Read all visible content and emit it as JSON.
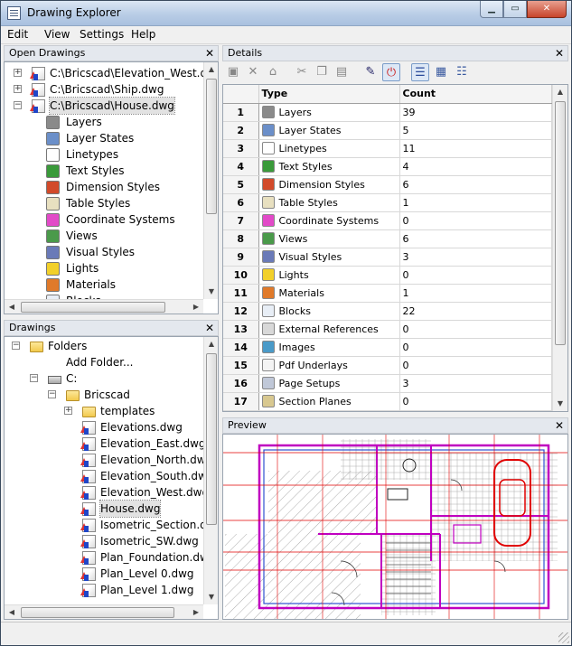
{
  "window": {
    "title": "Drawing Explorer"
  },
  "menu": [
    "Edit",
    "View",
    "Settings",
    "Help"
  ],
  "open_drawings": {
    "header": "Open Drawings",
    "files": [
      {
        "label": "C:\\Bricscad\\Elevation_West.dwg",
        "expanded": false
      },
      {
        "label": "C:\\Bricscad\\Ship.dwg",
        "expanded": false
      },
      {
        "label": "C:\\Bricscad\\House.dwg",
        "expanded": true,
        "selected": true
      }
    ],
    "children": [
      {
        "label": "Layers",
        "icon": "layers-icon"
      },
      {
        "label": "Layer States",
        "icon": "layer-states-icon"
      },
      {
        "label": "Linetypes",
        "icon": "linetypes-icon"
      },
      {
        "label": "Text Styles",
        "icon": "text-styles-icon"
      },
      {
        "label": "Dimension Styles",
        "icon": "dimension-styles-icon"
      },
      {
        "label": "Table Styles",
        "icon": "table-styles-icon"
      },
      {
        "label": "Coordinate Systems",
        "icon": "coordinate-systems-icon"
      },
      {
        "label": "Views",
        "icon": "views-icon"
      },
      {
        "label": "Visual Styles",
        "icon": "visual-styles-icon"
      },
      {
        "label": "Lights",
        "icon": "lights-icon"
      },
      {
        "label": "Materials",
        "icon": "materials-icon"
      },
      {
        "label": "Blocks",
        "icon": "blocks-icon"
      }
    ]
  },
  "drawings": {
    "header": "Drawings",
    "folders_label": "Folders",
    "add_folder_label": "Add Folder...",
    "drive_label": "C:",
    "bricscad_label": "Bricscad",
    "templates_label": "templates",
    "files": [
      "Elevations.dwg",
      "Elevation_East.dwg",
      "Elevation_North.dwg",
      "Elevation_South.dwg",
      "Elevation_West.dwg",
      "House.dwg",
      "Isometric_Section.dwg",
      "Isometric_SW.dwg",
      "Plan_Foundation.dwg",
      "Plan_Level 0.dwg",
      "Plan_Level 1.dwg"
    ],
    "selected_file": "House.dwg"
  },
  "details": {
    "header": "Details",
    "columns": {
      "type": "Type",
      "count": "Count"
    },
    "rows": [
      {
        "n": "1",
        "type": "Layers",
        "count": "39",
        "color": "#8a8a8a"
      },
      {
        "n": "2",
        "type": "Layer States",
        "count": "5",
        "color": "#6b8fc9"
      },
      {
        "n": "3",
        "type": "Linetypes",
        "count": "11",
        "color": "#ffffff"
      },
      {
        "n": "4",
        "type": "Text Styles",
        "count": "4",
        "color": "#3a9a3a"
      },
      {
        "n": "5",
        "type": "Dimension Styles",
        "count": "6",
        "color": "#d24a2a"
      },
      {
        "n": "6",
        "type": "Table Styles",
        "count": "1",
        "color": "#e8e0c0"
      },
      {
        "n": "7",
        "type": "Coordinate Systems",
        "count": "0",
        "color": "#e24ac8"
      },
      {
        "n": "8",
        "type": "Views",
        "count": "6",
        "color": "#4a9a4a"
      },
      {
        "n": "9",
        "type": "Visual Styles",
        "count": "3",
        "color": "#6a7ab8"
      },
      {
        "n": "10",
        "type": "Lights",
        "count": "0",
        "color": "#f2d02a"
      },
      {
        "n": "11",
        "type": "Materials",
        "count": "1",
        "color": "#e07a2a"
      },
      {
        "n": "12",
        "type": "Blocks",
        "count": "22",
        "color": "#e8eef6"
      },
      {
        "n": "13",
        "type": "External References",
        "count": "0",
        "color": "#d8d8d8"
      },
      {
        "n": "14",
        "type": "Images",
        "count": "0",
        "color": "#4a9ac8"
      },
      {
        "n": "15",
        "type": "Pdf Underlays",
        "count": "0",
        "color": "#f4f4f4"
      },
      {
        "n": "16",
        "type": "Page Setups",
        "count": "3",
        "color": "#c0c8d8"
      },
      {
        "n": "17",
        "type": "Section Planes",
        "count": "0",
        "color": "#d8c890"
      }
    ]
  },
  "preview": {
    "header": "Preview"
  },
  "colors": {
    "accent": "#7a9cc8",
    "plan_red": "#e00000",
    "plan_magenta": "#c000c0",
    "plan_blue": "#3050d0"
  }
}
